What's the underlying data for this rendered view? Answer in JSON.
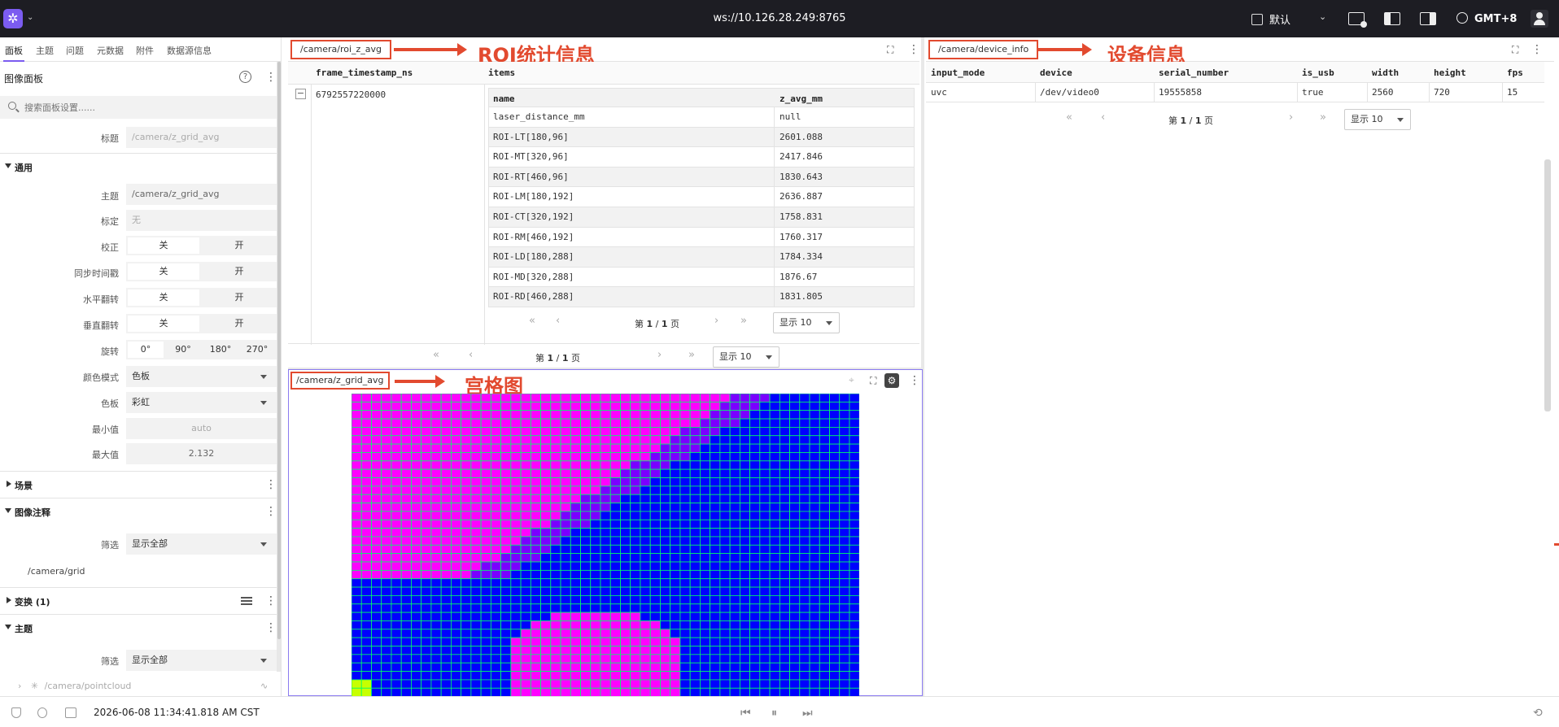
{
  "topbar": {
    "url": "ws://10.126.28.249:8765",
    "layout_label": "默认",
    "timezone": "GMT+8"
  },
  "sidebar": {
    "tabs": [
      "面板",
      "主题",
      "问题",
      "元数据",
      "附件",
      "数据源信息"
    ],
    "panel_title": "图像面板",
    "search_placeholder": "搜索面板设置......",
    "title_label": "标题",
    "title_placeholder": "/camera/z_grid_avg",
    "general_section": "通用",
    "topic_label": "主题",
    "topic_value": "/camera/z_grid_avg",
    "calib_label": "标定",
    "calib_value": "无",
    "rectify_label": "校正",
    "sync_label": "同步时间戳",
    "hflip_label": "水平翻转",
    "vflip_label": "垂直翻转",
    "off": "关",
    "on": "开",
    "rotate_label": "旋转",
    "rotations": [
      "0°",
      "90°",
      "180°",
      "270°"
    ],
    "colormode_label": "颜色模式",
    "colormode_value": "色板",
    "palette_label": "色板",
    "palette_value": "彩虹",
    "min_label": "最小值",
    "min_value": "auto",
    "max_label": "最大值",
    "max_value": "2.132",
    "scene_section": "场景",
    "annot_section": "图像注释",
    "filter_label": "筛选",
    "filter_value": "显示全部",
    "annot_topic": "/camera/grid",
    "transform_section": "变换 (1)",
    "topics_section": "主题",
    "topics_filter_label": "筛选",
    "topics_filter_value": "显示全部",
    "topics_item": "/camera/pointcloud"
  },
  "roi_panel": {
    "topic": "/camera/roi_z_avg",
    "annotation": "ROI统计信息",
    "columns": [
      "frame_timestamp_ns",
      "items"
    ],
    "timestamp": "6792557220000",
    "expand_symbol": "−",
    "inner_columns": [
      "name",
      "z_avg_mm"
    ],
    "rows": [
      [
        "laser_distance_mm",
        "null"
      ],
      [
        "ROI-LT[180,96]",
        "2601.088"
      ],
      [
        "ROI-MT[320,96]",
        "2417.846"
      ],
      [
        "ROI-RT[460,96]",
        "1830.643"
      ],
      [
        "ROI-LM[180,192]",
        "2636.887"
      ],
      [
        "ROI-CT[320,192]",
        "1758.831"
      ],
      [
        "ROI-RM[460,192]",
        "1760.317"
      ],
      [
        "ROI-LD[180,288]",
        "1784.334"
      ],
      [
        "ROI-MD[320,288]",
        "1876.67"
      ],
      [
        "ROI-RD[460,288]",
        "1831.805"
      ]
    ],
    "inner_page": {
      "prefix": "第",
      "current": "1",
      "sep": "/",
      "total": "1",
      "suffix": "页"
    },
    "inner_show": "显示 10",
    "outer_page": {
      "prefix": "第",
      "current": "1",
      "sep": "/",
      "total": "1",
      "suffix": "页"
    },
    "outer_show": "显示 10"
  },
  "device_panel": {
    "topic": "/camera/device_info",
    "annotation": "设备信息",
    "columns": [
      "input_mode",
      "device",
      "serial_number",
      "is_usb",
      "width",
      "height",
      "fps"
    ],
    "row": [
      "uvc",
      "/dev/video0",
      "19555858",
      "true",
      "2560",
      "720",
      "15"
    ],
    "page": {
      "prefix": "第",
      "current": "1",
      "sep": "/",
      "total": "1",
      "suffix": "页"
    },
    "show": "显示 10"
  },
  "grid_panel": {
    "topic": "/camera/z_grid_avg",
    "annotation": "宫格图"
  },
  "statusbar": {
    "time": "2026-06-08 11:34:41.818 AM CST"
  },
  "colors": {
    "accent": "#7b5cf0",
    "annotation": "#e24a2f",
    "grid_magenta": "#ff00ff",
    "grid_blue": "#0000ff",
    "grid_lines": "#00ff66"
  }
}
